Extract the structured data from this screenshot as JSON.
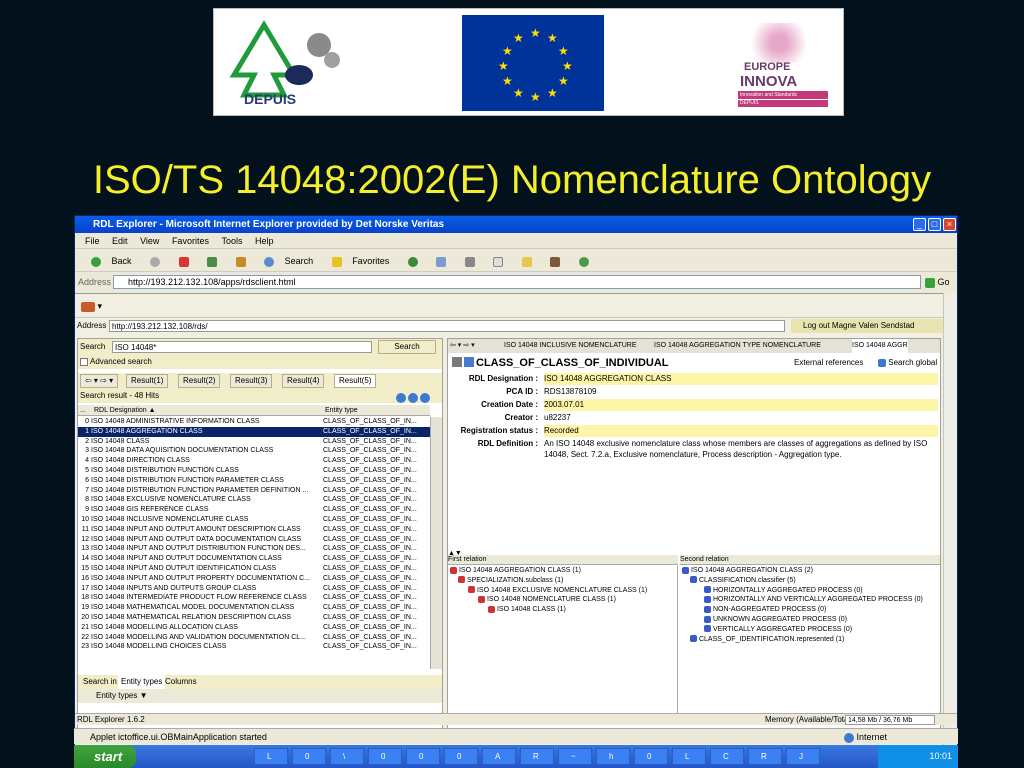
{
  "logos": {
    "depuis_label": "DEPUIS",
    "europe_line1": "EUROPE",
    "europe_line2": "INNOVA",
    "europe_tag1": "Innovation and Standards",
    "europe_tag2": "DEPUIS"
  },
  "slide_title": "ISO/TS 14048:2002(E) Nomenclature Ontology",
  "browser": {
    "title": "RDL Explorer - Microsoft Internet Explorer provided by Det Norske Veritas",
    "menu": [
      "File",
      "Edit",
      "View",
      "Favorites",
      "Tools",
      "Help"
    ],
    "toolbar": {
      "back": "Back",
      "search": "Search",
      "favorites": "Favorites"
    },
    "address_label": "Address",
    "address_url": "http://193.212.132.108/apps/rdsclient.html",
    "go_label": "Go",
    "status_text": "Applet ictoffice.ui.OBMainApplication started",
    "zone": "Internet"
  },
  "app": {
    "address_label": "Address",
    "address_url": "http://193.212.132.108/rds/",
    "logout": "Log out Magne Valen Sendstad",
    "search_label": "Search",
    "search_value": "ISO 14048*",
    "search_button": "Search",
    "advanced_search": "Advanced search",
    "result_tabs": [
      "Result(1)",
      "Result(2)",
      "Result(3)",
      "Result(4)",
      "Result(5)"
    ],
    "hits": "Search result - 48 Hits",
    "col_designation": "RDL Designation ▲",
    "col_type": "Entity type",
    "rows": [
      {
        "n": "0",
        "d": "ISO 14048 ADMINISTRATIVE INFORMATION CLASS",
        "t": "CLASS_OF_CLASS_OF_IN..."
      },
      {
        "n": "1",
        "d": "ISO 14048 AGGREGATION CLASS",
        "t": "CLASS_OF_CLASS_OF_IN..."
      },
      {
        "n": "2",
        "d": "ISO 14048 CLASS",
        "t": "CLASS_OF_CLASS_OF_IN..."
      },
      {
        "n": "3",
        "d": "ISO 14048 DATA AQUISITION DOCUMENTATION CLASS",
        "t": "CLASS_OF_CLASS_OF_IN..."
      },
      {
        "n": "4",
        "d": "ISO 14048 DIRECTION CLASS",
        "t": "CLASS_OF_CLASS_OF_IN..."
      },
      {
        "n": "5",
        "d": "ISO 14048 DISTRIBUTION FUNCTION CLASS",
        "t": "CLASS_OF_CLASS_OF_IN..."
      },
      {
        "n": "6",
        "d": "ISO 14048 DISTRIBUTION FUNCTION PARAMETER CLASS",
        "t": "CLASS_OF_CLASS_OF_IN..."
      },
      {
        "n": "7",
        "d": "ISO 14048 DISTRIBUTION FUNCTION PARAMETER DEFINITION ...",
        "t": "CLASS_OF_CLASS_OF_IN..."
      },
      {
        "n": "8",
        "d": "ISO 14048 EXCLUSIVE NOMENCLATURE CLASS",
        "t": "CLASS_OF_CLASS_OF_IN..."
      },
      {
        "n": "9",
        "d": "ISO 14048 GIS REFERENCE CLASS",
        "t": "CLASS_OF_CLASS_OF_IN..."
      },
      {
        "n": "10",
        "d": "ISO 14048 INCLUSIVE NOMENCLATURE CLASS",
        "t": "CLASS_OF_CLASS_OF_IN..."
      },
      {
        "n": "11",
        "d": "ISO 14048 INPUT AND OUTPUT AMOUNT DESCRIPTION CLASS",
        "t": "CLASS_OF_CLASS_OF_IN..."
      },
      {
        "n": "12",
        "d": "ISO 14048 INPUT AND OUTPUT DATA DOCUMENTATION CLASS",
        "t": "CLASS_OF_CLASS_OF_IN..."
      },
      {
        "n": "13",
        "d": "ISO 14048 INPUT AND OUTPUT DISTRIBUTION FUNCTION DES...",
        "t": "CLASS_OF_CLASS_OF_IN..."
      },
      {
        "n": "14",
        "d": "ISO 14048 INPUT AND OUTPUT DOCUMENTATION CLASS",
        "t": "CLASS_OF_CLASS_OF_IN..."
      },
      {
        "n": "15",
        "d": "ISO 14048 INPUT AND OUTPUT IDENTIFICATION CLASS",
        "t": "CLASS_OF_CLASS_OF_IN..."
      },
      {
        "n": "16",
        "d": "ISO 14048 INPUT AND OUTPUT PROPERTY DOCUMENTATION C...",
        "t": "CLASS_OF_CLASS_OF_IN..."
      },
      {
        "n": "17",
        "d": "ISO 14048 INPUTS AND OUTPUTS GROUP CLASS",
        "t": "CLASS_OF_CLASS_OF_IN..."
      },
      {
        "n": "18",
        "d": "ISO 14048 INTERMEDIATE PRODUCT FLOW REFERENCE CLASS",
        "t": "CLASS_OF_CLASS_OF_IN..."
      },
      {
        "n": "19",
        "d": "ISO 14048 MATHEMATICAL MODEL DOCUMENTATION CLASS",
        "t": "CLASS_OF_CLASS_OF_IN..."
      },
      {
        "n": "20",
        "d": "ISO 14048 MATHEMATICAL RELATION DESCRIPTION CLASS",
        "t": "CLASS_OF_CLASS_OF_IN..."
      },
      {
        "n": "21",
        "d": "ISO 14048 MODELLING ALLOCATION CLASS",
        "t": "CLASS_OF_CLASS_OF_IN..."
      },
      {
        "n": "22",
        "d": "ISO 14048 MODELLING AND VALIDATION DOCUMENTATION CL...",
        "t": "CLASS_OF_CLASS_OF_IN..."
      },
      {
        "n": "23",
        "d": "ISO 14048 MODELLING CHOICES CLASS",
        "t": "CLASS_OF_CLASS_OF_IN..."
      }
    ],
    "bottom_tabs": [
      "Search in",
      "Entity types",
      "Columns"
    ],
    "entity_types_header": "Entity types ▼",
    "right_tabs": [
      "ISO 14048 INCLUSIVE NOMENCLATURE",
      "ISO 14048 AGGREGATION TYPE NOMENCLATURE",
      "ISO 14048 AGGR"
    ],
    "detail_title": "CLASS_OF_CLASS_OF_INDIVIDUAL",
    "external_refs": "External references",
    "search_global": "Search global",
    "props": [
      {
        "k": "RDL Designation :",
        "v": "ISO 14048 AGGREGATION CLASS",
        "hl": true
      },
      {
        "k": "PCA ID :",
        "v": "RDS13878109",
        "hl": false
      },
      {
        "k": "Creation Date :",
        "v": "2003.07.01",
        "hl": true
      },
      {
        "k": "Creator :",
        "v": "u82237",
        "hl": false
      },
      {
        "k": "Registration status :",
        "v": "Recorded",
        "hl": true
      }
    ],
    "definition_label": "RDL Definition :",
    "definition": "An ISO 14048 exclusive nomenclature class whose members are classes of aggregations as defined by ISO 14048, Sect. 7.2.a, Exclusive nomenclature, Process description - Aggregation type.",
    "first_relation": "First relation",
    "second_relation": "Second relation",
    "tree_left": [
      "ISO 14048 AGGREGATION CLASS (1)",
      "SPECIALIZATION.subclass (1)",
      "ISO 14048 EXCLUSIVE NOMENCLATURE CLASS (1)",
      "ISO 14048 NOMENCLATURE CLASS (1)",
      "ISO 14048 CLASS (1)"
    ],
    "tree_right": [
      "ISO 14048 AGGREGATION CLASS (2)",
      "CLASSIFICATION.classifier (5)",
      "HORIZONTALLY AGGREGATED PROCESS (0)",
      "HORIZONTALLY AND VERTICALLY AGGREGATED PROCESS (0)",
      "NON-AGGREGATED PROCESS (0)",
      "UNKNOWN AGGREGATED PROCESS (0)",
      "VERTICALLY AGGREGATED PROCESS (0)",
      "CLASS_OF_IDENTIFICATION.represented (1)"
    ],
    "version": "RDL Explorer 1.6.2",
    "memory_label": "Memory (Available/Total)",
    "memory_value": "14,58 Mb / 36,76 Mb"
  },
  "taskbar": {
    "start": "start",
    "items": [
      "L",
      "0",
      "\\",
      "0",
      "0",
      "0",
      "A",
      "R",
      "~",
      "h",
      "0",
      "L",
      "C",
      "R",
      "J"
    ],
    "clock": "10:01"
  }
}
